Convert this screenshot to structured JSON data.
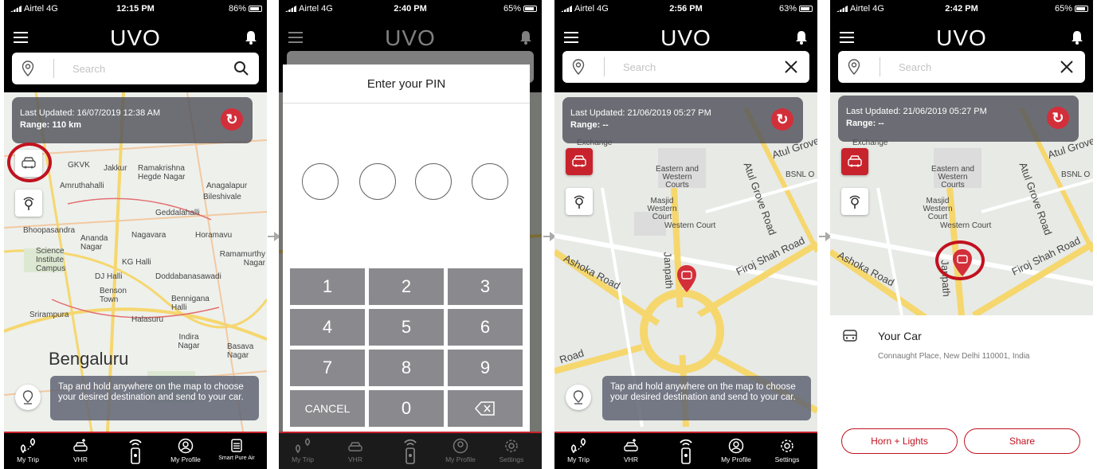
{
  "phones": [
    {
      "status": {
        "carrier": "Airtel  4G",
        "time": "12:15 PM",
        "battery": "86%"
      },
      "header": {
        "logo": "UVO",
        "search_placeholder": "Search",
        "search_action_icon": "search-icon"
      },
      "info": {
        "last_updated": "Last Updated: 16/07/2019 12:38 AM",
        "range": "Range: 110 km"
      },
      "hint": "Tap and hold anywhere on the map to choose your desired destination and send to your car.",
      "map_labels": [
        "GKVK",
        "Jakkur",
        "Ramakrishna Hegde Nagar",
        "Amruthahalli",
        "Anagalapur",
        "Bileshivale",
        "Geddalahalli",
        "Bhoopasandra",
        "Ananda Nagar",
        "Nagavara",
        "Horamavu",
        "Science Institute Campus",
        "KG Halli",
        "Ramamurthy Nagar",
        "DJ Halli",
        "Doddabanasawadi",
        "Benson Town",
        "Bennigana Halli",
        "Srirampura",
        "Halasuru",
        "Indira Nagar",
        "Basava Nagar",
        "Bengaluru"
      ],
      "tabs": [
        "My Trip",
        "VHR",
        "",
        "My Profile",
        "Smart Pure Air"
      ]
    },
    {
      "status": {
        "carrier": "Airtel  4G",
        "time": "2:40 PM",
        "battery": "65%"
      },
      "header": {
        "logo": "UVO"
      },
      "pin": {
        "title": "Enter your PIN",
        "keys": [
          "1",
          "2",
          "3",
          "4",
          "5",
          "6",
          "7",
          "8",
          "9",
          "CANCEL",
          "0",
          "⌫"
        ]
      },
      "tabs": [
        "My Trip",
        "VHR",
        "",
        "My Profile",
        "Settings"
      ]
    },
    {
      "status": {
        "carrier": "Airtel  4G",
        "time": "2:56 PM",
        "battery": "63%"
      },
      "header": {
        "logo": "UVO",
        "search_placeholder": "Search",
        "search_action_icon": "close-icon"
      },
      "info": {
        "last_updated": "Last Updated: 21/06/2019 05:27 PM",
        "range": "Range: --"
      },
      "hint": "Tap and hold anywhere on the map to choose your desired destination and send to your car.",
      "map_labels": [
        "Exchange",
        "Eastern and Western Courts",
        "Masjid Western Court",
        "Western Court",
        "Atul Grove",
        "BSNL O",
        "Atul Grove Road",
        "Janpath",
        "Ashoka Road",
        "Firoj Shah Road",
        "Road"
      ],
      "tabs": [
        "My Trip",
        "VHR",
        "",
        "My Profile",
        "Settings"
      ]
    },
    {
      "status": {
        "carrier": "Airtel  4G",
        "time": "2:42 PM",
        "battery": "65%"
      },
      "header": {
        "logo": "UVO",
        "search_placeholder": "Search",
        "search_action_icon": "close-icon"
      },
      "info": {
        "last_updated": "Last Updated: 21/06/2019 05:27 PM",
        "range": "Range: --"
      },
      "map_labels": [
        "Exchange",
        "Eastern and Western Courts",
        "Masjid Western Court",
        "Western Court",
        "Atul Grove",
        "BSNL O",
        "Atul Grove Road",
        "Janpath",
        "Ashoka Road",
        "Firoj Shah Road"
      ],
      "car": {
        "title": "Your Car",
        "address": "Connaught Place, New Delhi 110001, India"
      },
      "buttons": {
        "horn": "Horn + Lights",
        "share": "Share"
      }
    }
  ],
  "colors": {
    "accent": "#c8232c",
    "highlight_ring": "#c1121f",
    "appbar": "#000000"
  }
}
